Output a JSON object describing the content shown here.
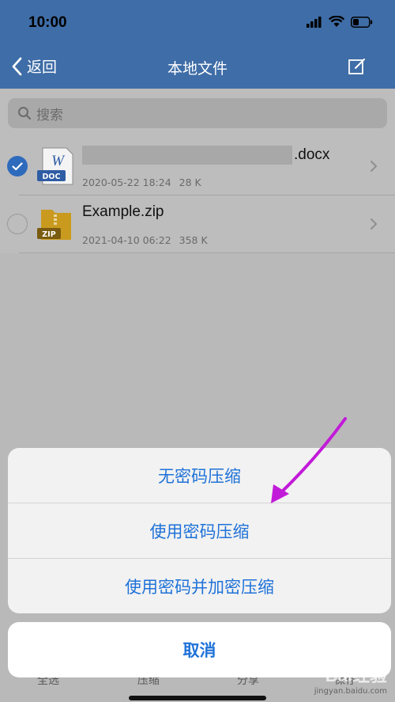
{
  "status_bar": {
    "time": "10:00"
  },
  "nav": {
    "back_label": "返回",
    "title": "本地文件"
  },
  "search": {
    "placeholder": "搜索"
  },
  "files": [
    {
      "name_suffix": ".docx",
      "icon_badge": "DOC",
      "icon_letter": "W",
      "date": "2020-05-22 18:24",
      "size": "28 K",
      "selected": true
    },
    {
      "name": "Example.zip",
      "icon_badge": "ZIP",
      "date": "2021-04-10 06:22",
      "size": "358 K",
      "selected": false
    }
  ],
  "action_sheet": {
    "options": [
      "无密码压缩",
      "使用密码压缩",
      "使用密码并加密压缩"
    ],
    "cancel_label": "取消"
  },
  "toolbar": {
    "select_all": "全选",
    "compress": "压缩",
    "share": "分享",
    "save": "保存"
  },
  "watermark": {
    "main": "Bai经验",
    "sub": "jingyan.baidu.com"
  },
  "colors": {
    "nav_bg": "#3f6da7",
    "accent": "#1f72d8",
    "annotation_arrow": "#c21ad9"
  }
}
